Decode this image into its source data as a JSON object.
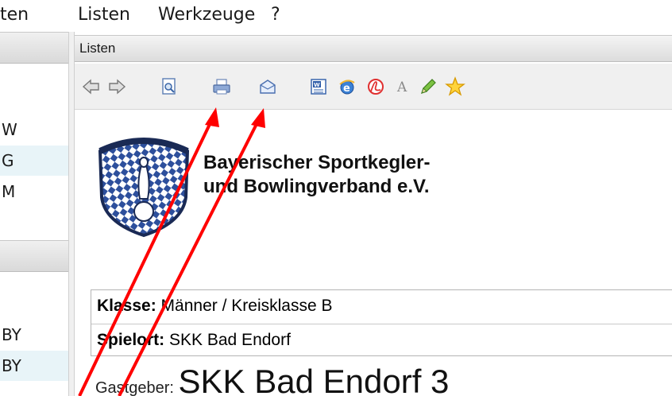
{
  "menubar": {
    "items": [
      "ten",
      "Listen",
      "Werkzeuge",
      "?"
    ]
  },
  "left_panel": {
    "rows_top": [
      "W",
      "G",
      "M"
    ],
    "rows_bottom": [
      "BY",
      "BY"
    ]
  },
  "listen_panel": {
    "title": "Listen",
    "toolbar": [
      {
        "name": "back-icon"
      },
      {
        "name": "forward-icon"
      },
      {
        "name": "print-preview-icon"
      },
      {
        "name": "print-icon"
      },
      {
        "name": "email-icon"
      },
      {
        "name": "word-export-icon"
      },
      {
        "name": "internet-explorer-icon"
      },
      {
        "name": "pdf-icon"
      },
      {
        "name": "font-icon"
      },
      {
        "name": "pencil-icon"
      },
      {
        "name": "favorite-star-icon"
      }
    ]
  },
  "document": {
    "org_line1": "Bayerischer Sportkegler-",
    "org_line2": "und Bowlingverband e.V.",
    "klasse_label": "Klasse:",
    "klasse_value": " Männer / Kreisklasse B",
    "spielort_label": "Spielort:",
    "spielort_value": " SKK Bad Endorf",
    "gastgeber_label": "Gastgeber: ",
    "gastgeber_value": "SKK Bad Endorf 3"
  },
  "colors": {
    "annotation_arrow": "#ff0000",
    "alt_row": "#e8f4f8",
    "toolbar_bg": "#f0f0f0"
  }
}
